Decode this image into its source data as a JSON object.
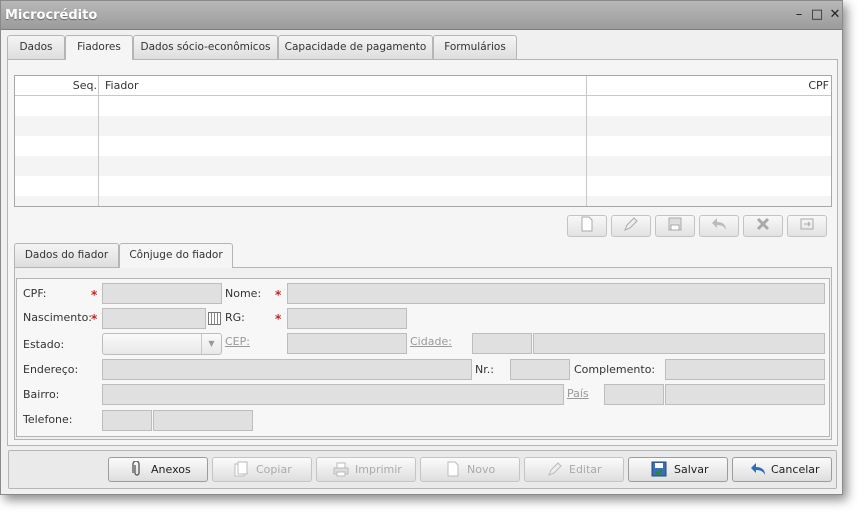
{
  "window": {
    "title": "Microcrédito",
    "minimize": "–",
    "maximize": "□",
    "close": "✕"
  },
  "main_tabs": [
    {
      "label": "Dados"
    },
    {
      "label": "Fiadores"
    },
    {
      "label": "Dados sócio-econômicos"
    },
    {
      "label": "Capacidade de pagamento"
    },
    {
      "label": "Formulários"
    }
  ],
  "grid": {
    "columns": [
      "Seq.",
      "Fiador",
      "CPF"
    ],
    "rows": []
  },
  "toolbar_icons": [
    "new-document-icon",
    "edit-pencil-icon",
    "save-disk-icon",
    "undo-arrow-icon",
    "delete-x-icon",
    "refresh-icon"
  ],
  "sub_tabs": [
    {
      "label": "Dados do fiador"
    },
    {
      "label": "Cônjuge do fiador"
    }
  ],
  "form": {
    "cpf_label": "CPF:",
    "nome_label": "Nome:",
    "nascimento_label": "Nascimento:",
    "rg_label": "RG:",
    "estado_label": "Estado:",
    "cep_label": "CEP:",
    "cidade_label": "Cidade:",
    "endereco_label": "Endereço:",
    "nr_label": "Nr.:",
    "complemento_label": "Complemento:",
    "bairro_label": "Bairro:",
    "pais_label": "País",
    "telefone_label": "Telefone:",
    "required_mark": "*"
  },
  "buttons": {
    "anexos": "Anexos",
    "copiar": "Copiar",
    "imprimir": "Imprimir",
    "novo": "Novo",
    "editar": "Editar",
    "salvar": "Salvar",
    "cancelar": "Cancelar"
  },
  "colors": {
    "required": "#cc2222",
    "save_icon": "#2a8a2a",
    "cancel_icon": "#2a6fbf"
  }
}
